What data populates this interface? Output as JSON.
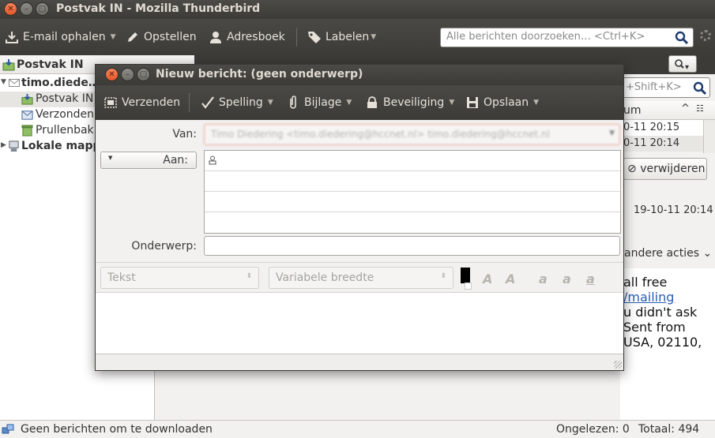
{
  "main_window": {
    "title": "Postvak IN - Mozilla Thunderbird",
    "toolbar": {
      "get_mail": "E-mail ophalen",
      "compose": "Opstellen",
      "address_book": "Adresboek",
      "tag": "Labelen"
    },
    "search_placeholder": "Alle berichten doorzoeken… <Ctrl+K>"
  },
  "folder_pane": {
    "header": "Postvak IN",
    "account": "timo.diede…",
    "folders": [
      "Postvak IN",
      "Verzonden",
      "Prullenbak"
    ],
    "local_folders": "Lokale mapp…"
  },
  "message_list": {
    "quick_search_placeholder": "+Shift+K>",
    "date_column": "um",
    "rows": [
      "0-11 20:15",
      "0-11 20:14"
    ]
  },
  "message_view": {
    "delete_button": "verwijderen",
    "date": "19-10-11 20:14",
    "more_actions": "andere acties",
    "body_lines": [
      "all free",
      "/mailing",
      "u didn't ask",
      "Sent from",
      "USA, 02110,"
    ]
  },
  "status_bar": {
    "text": "Geen berichten om te downloaden",
    "unread": "Ongelezen: 0",
    "total": "Totaal: 494"
  },
  "compose": {
    "title": "Nieuw bericht: (geen onderwerp)",
    "toolbar": {
      "send": "Verzenden",
      "spelling": "Spelling",
      "attach": "Bijlage",
      "security": "Beveiliging",
      "save": "Opslaan"
    },
    "from_label": "Van:",
    "from_value": "Timo Diedering <timo.diedering@hccnet.nl>    timo.diedering@hccnet.nl",
    "to_label": "Aan:",
    "subject_label": "Onderwerp:",
    "format": {
      "paragraph": "Tekst",
      "font": "Variabele breedte"
    }
  },
  "colors": {
    "titlebar": "#3c3b37",
    "close_button": "#e2572a",
    "link": "#2a5db0"
  }
}
